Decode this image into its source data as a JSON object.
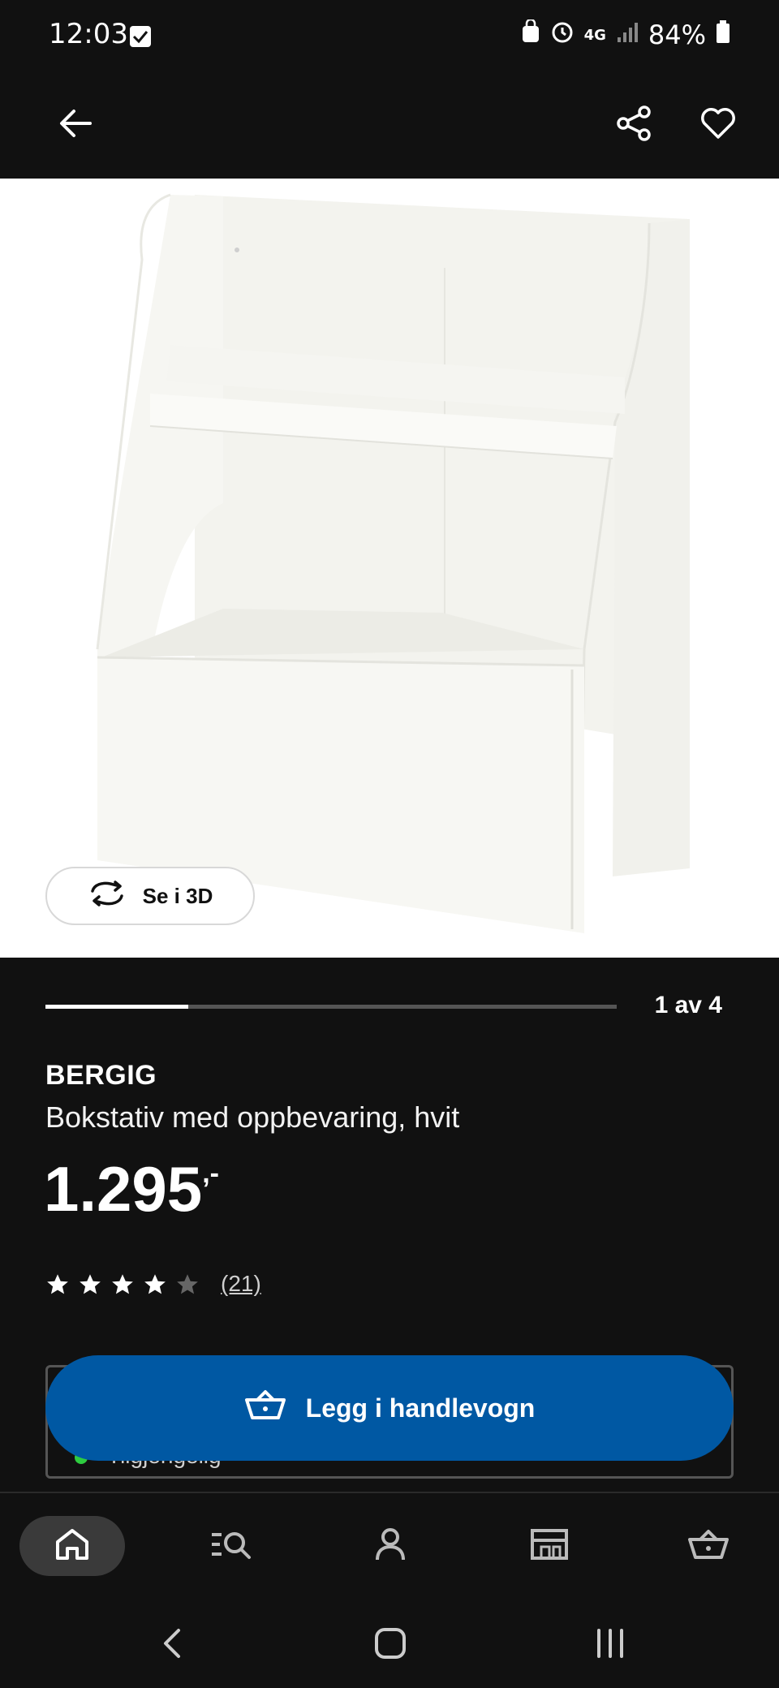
{
  "status_bar": {
    "time": "12:03",
    "network": "4G",
    "battery": "84%",
    "icons": [
      "check-box-icon",
      "bag-icon",
      "alarm-icon",
      "signal-icon",
      "battery-icon"
    ]
  },
  "app_bar": {
    "icons": [
      "back-arrow-icon",
      "share-icon",
      "heart-icon"
    ]
  },
  "gallery": {
    "view_3d_label": "Se i 3D",
    "page_indicator": "1 av 4",
    "current": 1,
    "total": 4
  },
  "product": {
    "brand": "BERGIG",
    "description": "Bokstativ med oppbevaring, hvit",
    "price": "1.295",
    "price_suffix": ",-",
    "rating": 4,
    "rating_max": 5,
    "review_count": "(21)",
    "availability": "Tilgjengelig"
  },
  "cart_button": {
    "label": "Legg i handlevogn"
  },
  "bottom_nav": {
    "items": [
      "home-icon",
      "search-list-icon",
      "profile-icon",
      "store-icon",
      "cart-icon"
    ],
    "active": "home-icon"
  },
  "colors": {
    "background": "#111111",
    "accent": "#0058a3",
    "image_bg": "#ffffff"
  }
}
